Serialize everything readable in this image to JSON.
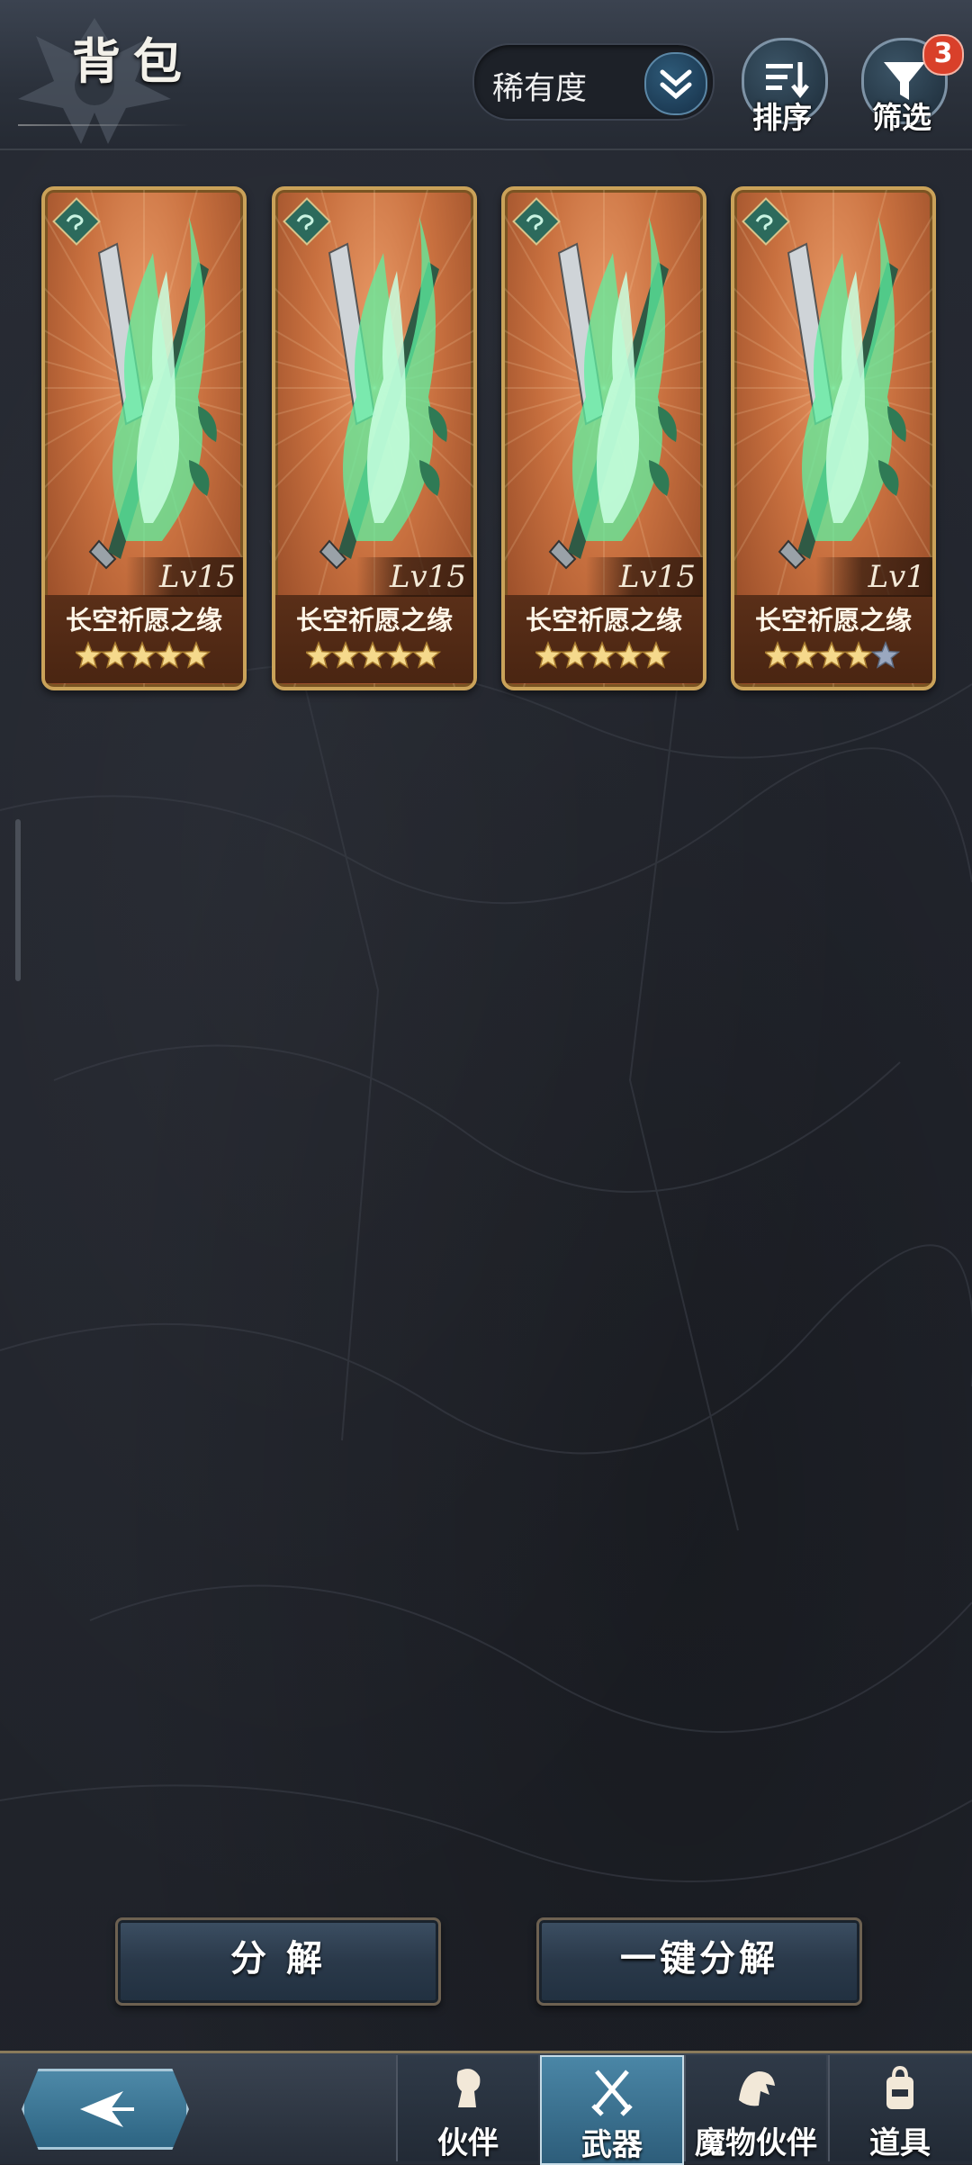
{
  "header": {
    "title": "背包",
    "sort_selector": {
      "label": "稀有度",
      "icon": "chevron-double-down-icon"
    },
    "sort_button": {
      "label": "排序",
      "icon": "sort-list-icon"
    },
    "filter_button": {
      "label": "筛选",
      "icon": "funnel-icon",
      "badge": "3"
    }
  },
  "weapons": [
    {
      "name": "长空祈愿之缘",
      "level": "Lv15",
      "stars": 5,
      "max_stars": 5,
      "element_icon": "wind-element-icon"
    },
    {
      "name": "长空祈愿之缘",
      "level": "Lv15",
      "stars": 5,
      "max_stars": 5,
      "element_icon": "wind-element-icon"
    },
    {
      "name": "长空祈愿之缘",
      "level": "Lv15",
      "stars": 5,
      "max_stars": 5,
      "element_icon": "wind-element-icon"
    },
    {
      "name": "长空祈愿之缘",
      "level": "Lv1",
      "stars": 4,
      "max_stars": 5,
      "element_icon": "wind-element-icon"
    }
  ],
  "actions": {
    "decompose": "分 解",
    "quick_decompose": "一键分解"
  },
  "bottom_nav": {
    "back_icon": "back-arrow-icon",
    "tabs": [
      {
        "label": "伙伴",
        "icon": "companion-icon",
        "active": false
      },
      {
        "label": "武器",
        "icon": "crossed-swords-icon",
        "active": true
      },
      {
        "label": "魔物伙伴",
        "icon": "monster-icon",
        "active": false
      },
      {
        "label": "道具",
        "icon": "backpack-icon",
        "active": false
      }
    ]
  },
  "colors": {
    "card_gold_border": "#caa259",
    "card_background": "#c8703f",
    "active_tab": "#4a86a6",
    "badge": "#d9402a",
    "flame_green": "#5ef0a0"
  }
}
